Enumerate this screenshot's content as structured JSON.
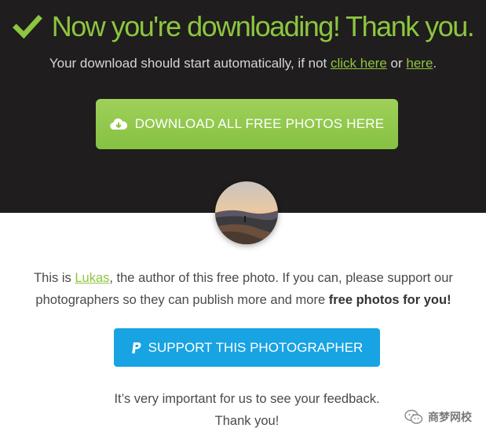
{
  "header": {
    "headline": "Now you're downloading! Thank you.",
    "subline_prefix": "Your download should start automatically, if not ",
    "link_click_here": "click here",
    "subline_or": " or ",
    "link_here": "here",
    "subline_suffix": "."
  },
  "download_button": {
    "icon": "cloud-download-icon",
    "label": "DOWNLOAD ALL FREE PHOTOS HERE"
  },
  "author": {
    "prefix": "This is ",
    "name": "Lukas",
    "middle": ", the author of this free photo. If you can, please support our photographers so they can publish more and more ",
    "bold": "free photos for you!"
  },
  "support_button": {
    "icon": "paypal-icon",
    "label": "SUPPORT THIS PHOTOGRAPHER"
  },
  "feedback": {
    "line1": "It’s very important for us to see your feedback.",
    "line2": "Thank you!"
  },
  "watermark": {
    "text": "商梦网校",
    "icon": "wechat-icon"
  },
  "colors": {
    "accent_green": "#8cc63f",
    "dark_bg": "#1f1d1d",
    "support_blue": "#18a3e3"
  }
}
